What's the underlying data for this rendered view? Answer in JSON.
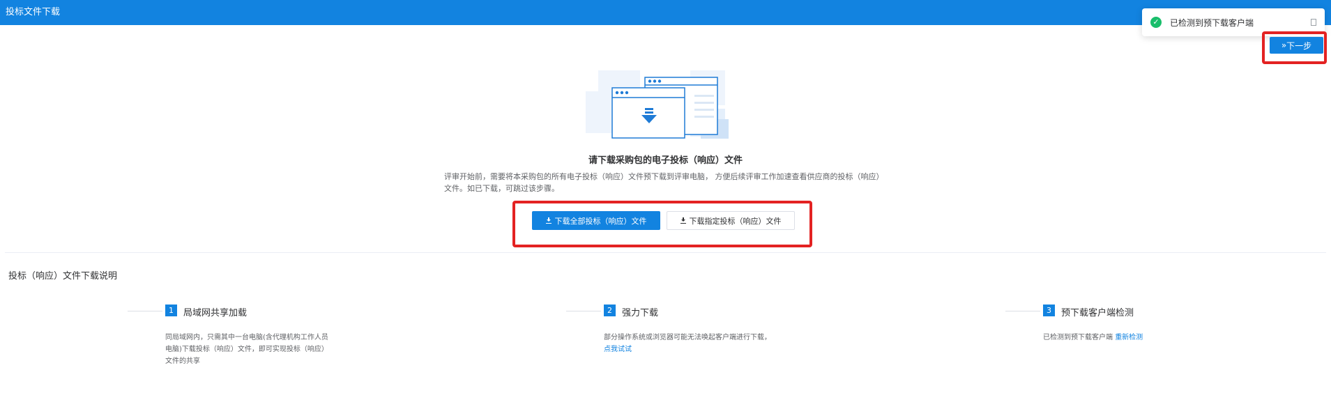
{
  "header": {
    "title": "投标文件下载"
  },
  "toast": {
    "message": "已检测到预下载客户端"
  },
  "next_button": {
    "label": "下一步"
  },
  "main": {
    "title": "请下载采购包的电子投标（响应）文件",
    "description": "评审开始前，需要将本采购包的所有电子投标（响应）文件预下载到评审电脑， 方便后续评审工作加速查看供应商的投标（响应）文件。如已下载，可跳过该步骤。",
    "download_all_label": "下载全部投标（响应）文件",
    "download_specific_label": "下载指定投标（响应）文件"
  },
  "instructions": {
    "title": "投标（响应）文件下载说明",
    "steps": [
      {
        "num": "1",
        "title": "局域网共享加载",
        "desc": "同局域网内，只需其中一台电脑(含代理机构工作人员电脑)下载投标（响应）文件，即可实现投标（响应）文件的共享"
      },
      {
        "num": "2",
        "title": "强力下载",
        "desc": "部分操作系统或浏览器可能无法唤起客户端进行下载，",
        "link": "点我试试"
      },
      {
        "num": "3",
        "title": "预下载客户端检测",
        "desc": "已检测到预下载客户端 ",
        "link": "重新检测"
      }
    ]
  },
  "colors": {
    "primary": "#1283e0",
    "highlight_frame": "#e32222",
    "success": "#19be6b"
  },
  "icons": [
    "download-icon",
    "check-circle-icon",
    "close-icon",
    "double-chevron-right-icon"
  ]
}
